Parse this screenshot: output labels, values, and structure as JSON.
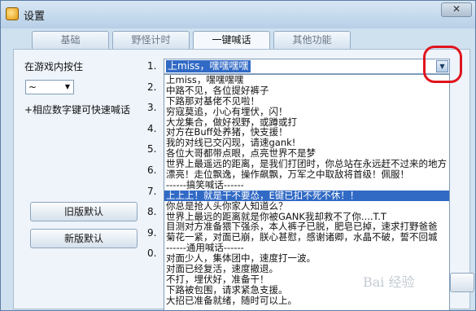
{
  "window": {
    "title": "设置",
    "close_label": "✕"
  },
  "tabs": [
    {
      "label": "基础",
      "active": false
    },
    {
      "label": "野怪计时",
      "active": false
    },
    {
      "label": "一键喊话",
      "active": true
    },
    {
      "label": "其他功能",
      "active": false
    }
  ],
  "left": {
    "hotkey_label": "在游戏内按住",
    "hotkey_value": "~",
    "hint": "+相应数字键可快速喊话",
    "old_default_button": "旧版默认",
    "new_default_button": "新版默认"
  },
  "slots": [
    "1.",
    "2.",
    "3.",
    "4.",
    "5.",
    "6.",
    "7.",
    "8.",
    "9.",
    "0."
  ],
  "combo": {
    "value": "上miss，嘿嘿嘿嘿"
  },
  "dropdown_items": [
    "上miss，嘿嘿嘿嘿",
    "中路不见，各位提好裤子",
    "下路那对基佬不见啦！",
    "穷寇莫追，小心有埋伏，闪！",
    "大龙集合，做好视野，或蹲或打",
    "对方在Buff处养猪，快支援！",
    "我的对线已交闪现，请速gank!",
    "各位大哥都带点眼，点亮世界不是梦",
    "世界上最遥远的距离，是我们打团时，你总站在永远赶不过来的地方",
    "漂亮！走位飘逸，操作飙飘，万军之中取敌将首级！佩服！",
    "------搞笑喊话------",
    "上上上！就是干不要怂，E键已扣不死不休！！",
    "你总是抢人头你家人知道么？",
    "世界上最远的距离就是你被GANK我却救不了你....T.T",
    "目测对方准备猥下强杀，本人裤子已脱，肥皂已掉，速求打野爸爸",
    "菊花一紧，对面已崩，朕心甚慰，感谢诸卿，水晶不破，誓不回城",
    "------通用喊话------",
    "对面少人，集体团中，速度打一波。",
    "对面已经复活，速度撤退。",
    "不打，埋伏好，准备干！",
    "下路被包围，请求紧急支援。",
    "大招已准备就绪，随时可以上。"
  ],
  "highlighted_index": 11,
  "watermark": "Bai 经验"
}
